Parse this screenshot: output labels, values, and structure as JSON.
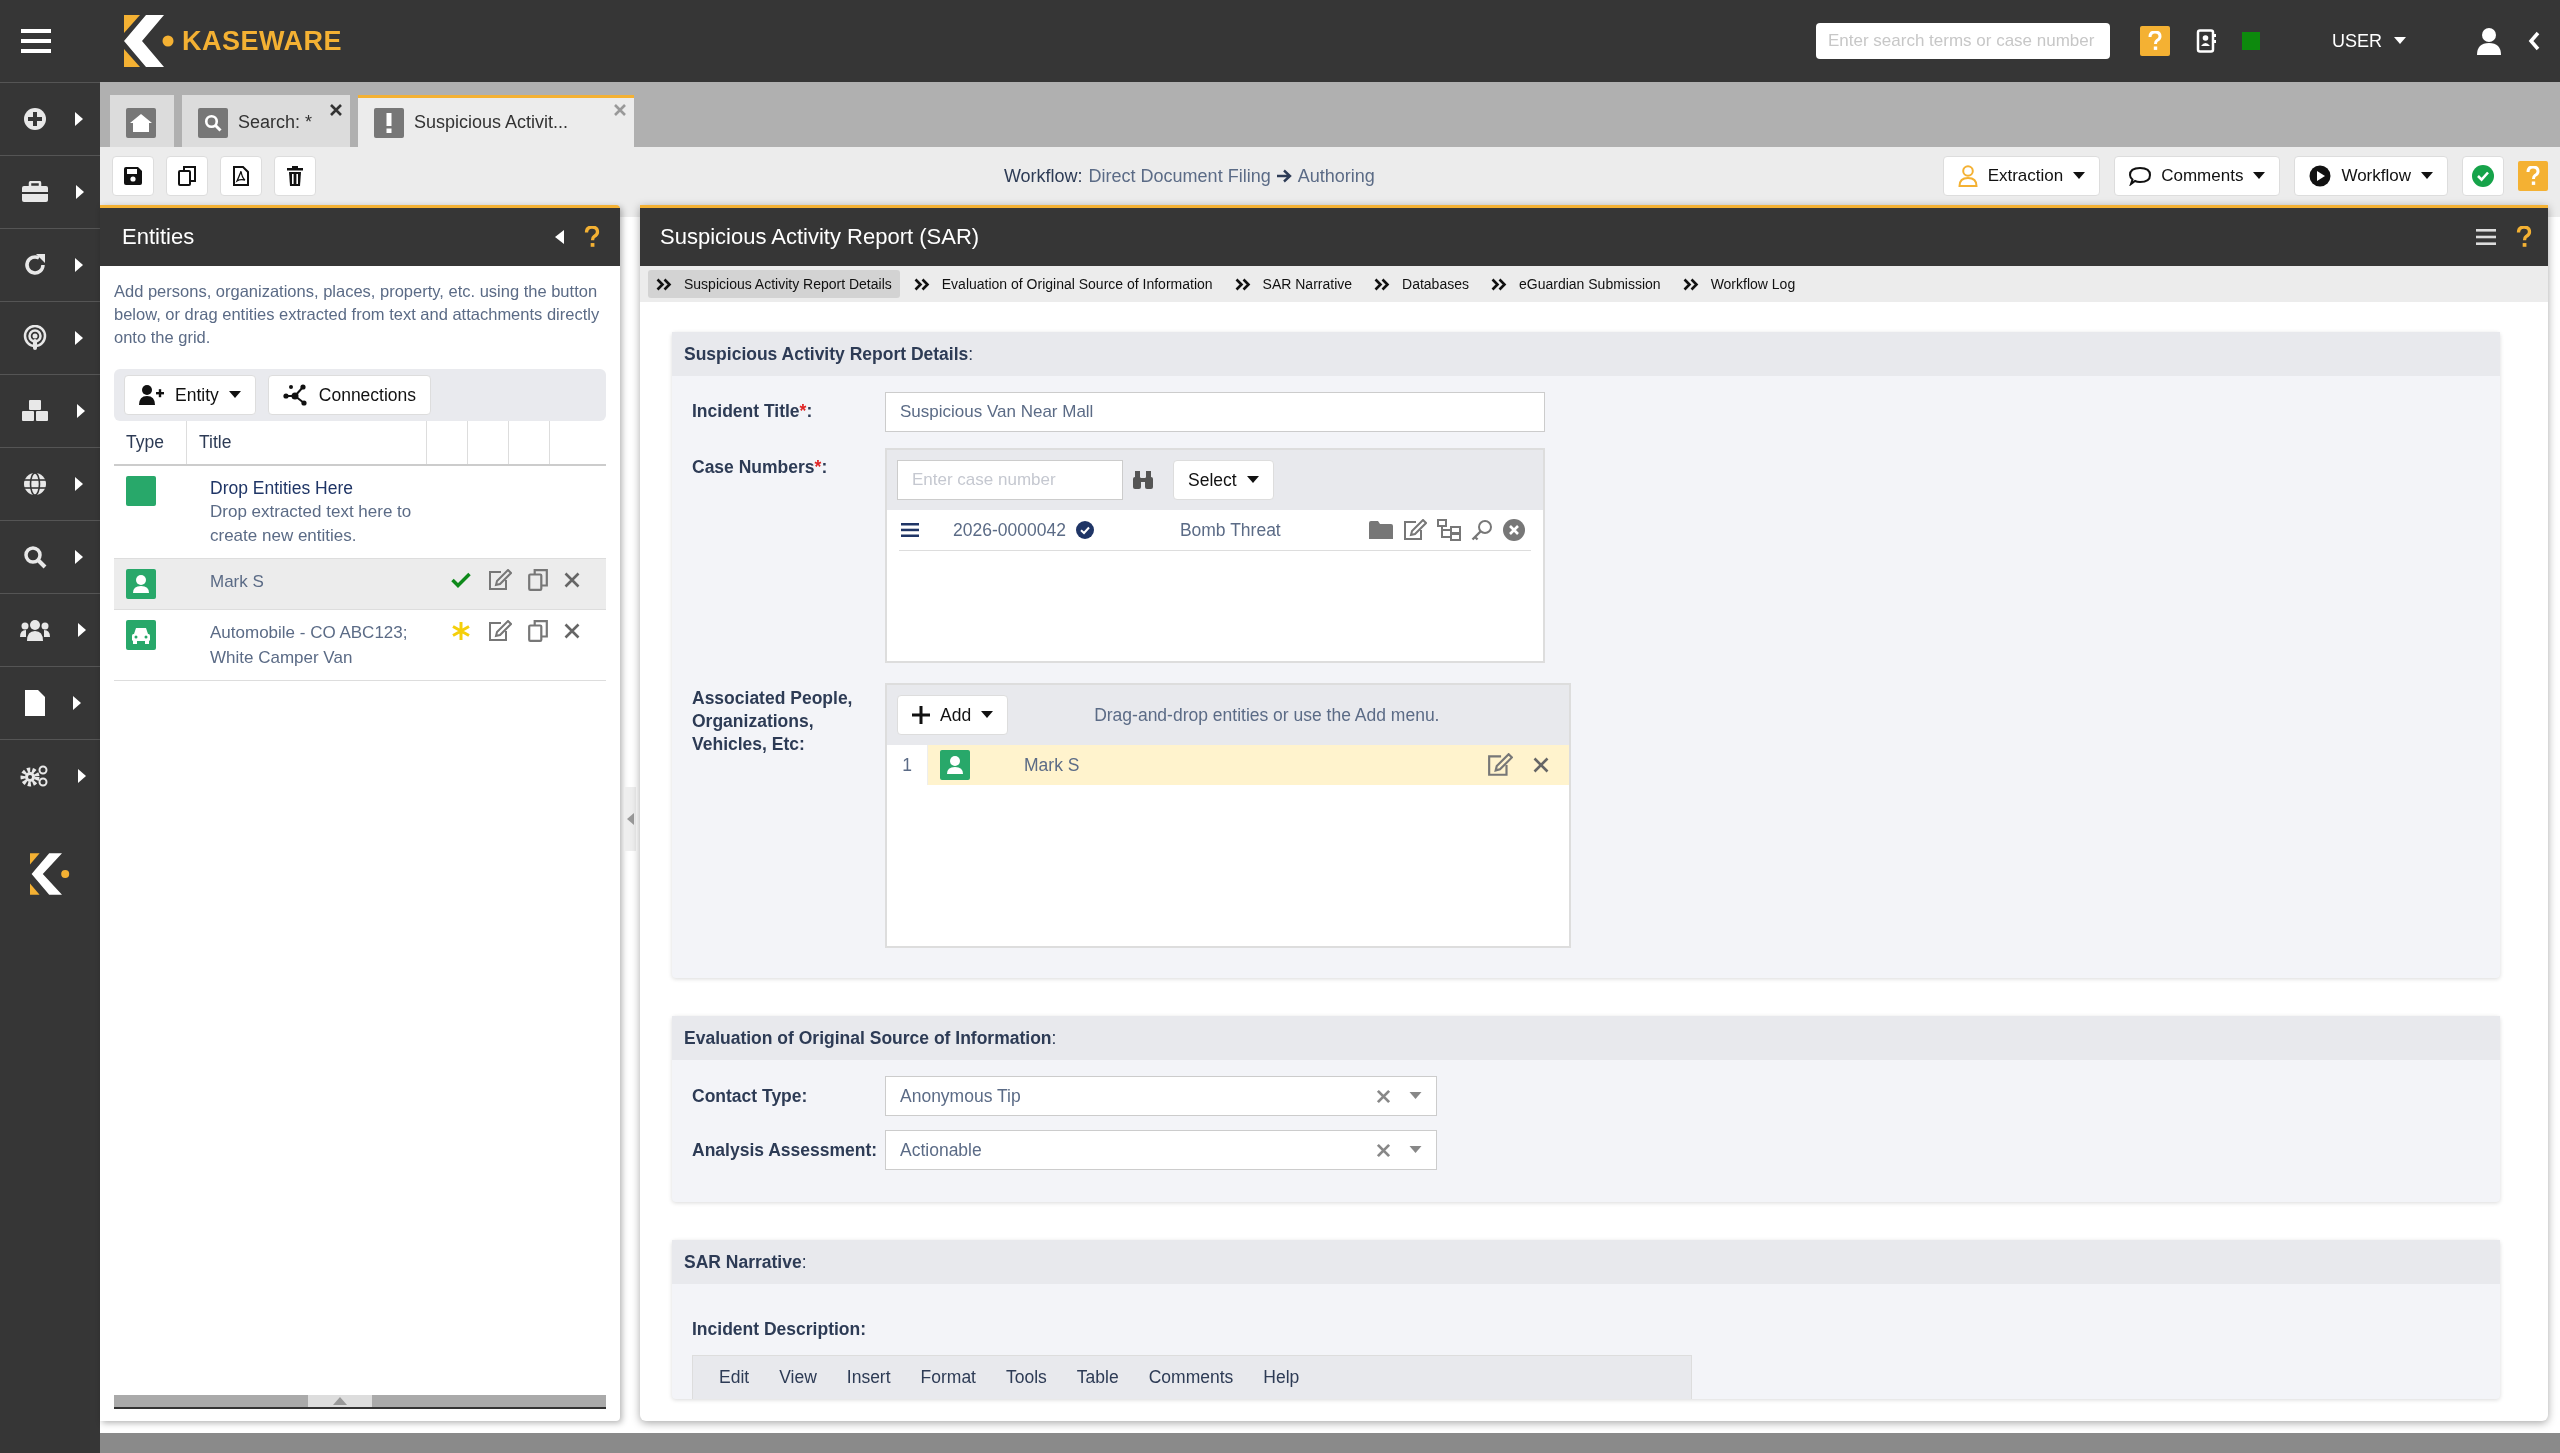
{
  "header": {
    "brand": "KASEWARE",
    "search_placeholder": "Enter search terms or case number",
    "user_menu": "USER"
  },
  "tabs": [
    {
      "kind": "home",
      "selected": false,
      "closable": false
    },
    {
      "kind": "search",
      "label": "Search: *",
      "selected": false,
      "closable": true
    },
    {
      "kind": "alert",
      "label": "Suspicious Activit...",
      "selected": true,
      "closable": true
    }
  ],
  "workflow": {
    "label": "Workflow:",
    "path": "Direct Document Filing",
    "stage": "Authoring"
  },
  "actions": [
    {
      "kind": "person",
      "label": "Extraction"
    },
    {
      "kind": "comment",
      "label": "Comments"
    },
    {
      "kind": "play",
      "label": "Workflow"
    }
  ],
  "entities": {
    "title": "Entities",
    "intro": "Add persons, organizations, places, property, etc. using the button below, or drag entities extracted from text and attachments directly onto the grid.",
    "add_button": "Entity",
    "connections_button": "Connections",
    "columns": [
      "Type",
      "Title"
    ],
    "drop_zone": {
      "title": "Drop Entities Here",
      "hint": "Drop extracted text here to create new entities."
    },
    "rows": [
      {
        "kind": "person",
        "title": "Mark S",
        "verified": true,
        "selected": true
      },
      {
        "kind": "vehicle",
        "title": "Automobile - CO ABC123; White Camper Van",
        "verified": false,
        "selected": false
      }
    ]
  },
  "report": {
    "title": "Suspicious Activity Report (SAR)",
    "steps": [
      {
        "label": "Suspicious Activity Report Details",
        "selected": true
      },
      {
        "label": "Evaluation of Original Source of Information",
        "selected": false
      },
      {
        "label": "SAR Narrative",
        "selected": false
      },
      {
        "label": "Databases",
        "selected": false
      },
      {
        "label": "eGuardian Submission",
        "selected": false
      },
      {
        "label": "Workflow Log",
        "selected": false
      }
    ],
    "details": {
      "title": "**Suspicious Activity Report Details**:",
      "incident_title": {
        "label": "Incident Title",
        "required_mark": "*",
        "colon": ":",
        "value": "Suspicious Van Near Mall"
      },
      "case_numbers": {
        "label": "Case Numbers",
        "required_mark": "*",
        "colon": ":",
        "placeholder": "Enter case number",
        "select": "Select",
        "cases": [
          {
            "number": "2026-0000042",
            "verified": true,
            "type": "Bomb Threat"
          }
        ]
      },
      "associated": {
        "label": "Associated People, Organizations, Vehicles, Etc:",
        "add": "Add",
        "hint": "Drag-and-drop entities or use the Add menu.",
        "items": [
          {
            "index": "1",
            "kind": "person",
            "name": "Mark S"
          }
        ]
      }
    },
    "evaluation": {
      "title": "**Evaluation of Original Source of Information**:",
      "fields": [
        {
          "label": "Contact Type:",
          "value": "Anonymous Tip"
        },
        {
          "label": "Analysis Assessment:",
          "value": "Actionable"
        }
      ]
    },
    "narrative": {
      "title": "**SAR Narrative**:",
      "field_label": "Incident Description:",
      "editor_menu": [
        "Edit",
        "View",
        "Insert",
        "Format",
        "Tools",
        "Table",
        "Comments",
        "Help"
      ]
    }
  }
}
